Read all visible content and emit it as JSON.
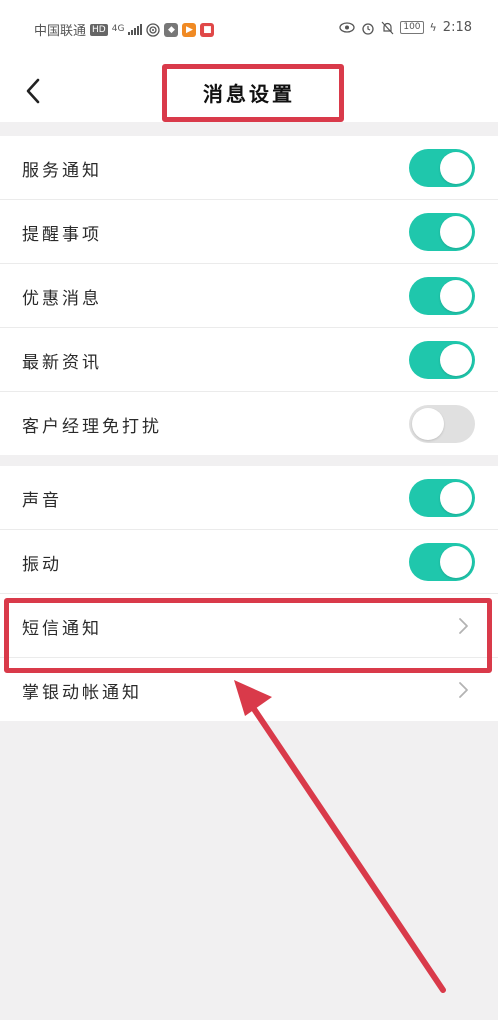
{
  "status_bar": {
    "carrier": "中国联通",
    "hd": "HD",
    "network": "4G",
    "battery": "100",
    "time": "2:18"
  },
  "header": {
    "title": "消息设置"
  },
  "group1": [
    {
      "label": "服务通知",
      "on": true
    },
    {
      "label": "提醒事项",
      "on": true
    },
    {
      "label": "优惠消息",
      "on": true
    },
    {
      "label": "最新资讯",
      "on": true
    },
    {
      "label": "客户经理免打扰",
      "on": false
    }
  ],
  "group2": [
    {
      "label": "声音",
      "on": true
    },
    {
      "label": "振动",
      "on": true
    }
  ],
  "nav_items": [
    {
      "label": "短信通知"
    },
    {
      "label": "掌银动帐通知"
    }
  ],
  "colors": {
    "toggle_on": "#1fc7ac",
    "toggle_off": "#e0e0e0",
    "annotation": "#d93a4a"
  }
}
